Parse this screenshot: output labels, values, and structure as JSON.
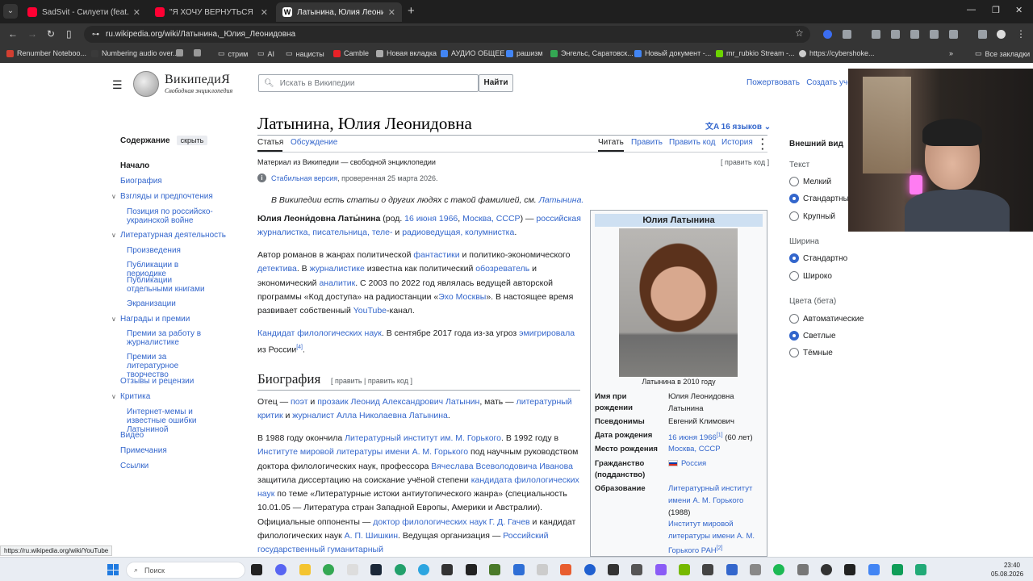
{
  "browser": {
    "tabs": [
      {
        "title": "SadSvit - Силуети (feat. СТРУКТ",
        "color": "#ff0033"
      },
      {
        "title": "\"Я ХОЧУ ВЕРНУТЬСЯ В РОССИЮ",
        "color": "#ff0033"
      },
      {
        "title": "Латынина, Юлия Леонидовна",
        "color": "#ffffff"
      }
    ],
    "url": "ru.wikipedia.org/wiki/Латынина,_Юлия_Леонидовна",
    "bookmarks": [
      "Renumber Noteboo...",
      "Numbering audio over...",
      "стрим",
      "AI",
      "нацисты",
      "Camble",
      "Новая вкладка",
      "АУДИО ОБЩЕЕ",
      "рашизм",
      "Энгельс, Саратовск...",
      "Новый документ -...",
      "mr_rubkio Stream -...",
      "https://cybershoke...",
      "Все закладки"
    ],
    "bookmark_colors": [
      "#d23f31",
      "#3a3a3a",
      "#888",
      "#888",
      "#888",
      "#e82127",
      "#aaa",
      "#4285f4",
      "#4285f4",
      "#34a853",
      "#4285f4",
      "#6cd400",
      "#ccc",
      "#888"
    ]
  },
  "wiki": {
    "wordmark": "ВикипедиЯ",
    "tagline": "Свободная энциклопедия",
    "search_placeholder": "Искать в Википедии",
    "search_button": "Найти",
    "donate": "Пожертвовать",
    "create_account": "Создать учётн",
    "toc_title": "Содержание",
    "toc_hide": "скрыть",
    "toc": [
      "Начало",
      "Биография",
      "Взгляды и предпочтения",
      "Позиция по российско-украинской войне",
      "Литературная деятельность",
      "Произведения",
      "Публикации в периодике",
      "Публикации отдельными книгами",
      "Экранизации",
      "Награды и премии",
      "Премии за работу в журналистике",
      "Премии за литературное творчество",
      "Отзывы и рецензии",
      "Критика",
      "Интернет-мемы и известные ошибки Латыниной",
      "Видео",
      "Примечания",
      "Ссылки"
    ],
    "title": "Латынина, Юлия Леонидовна",
    "languages": "16 языков",
    "tab_article": "Статья",
    "tab_talk": "Обсуждение",
    "tab_read": "Читать",
    "tab_edit": "Править",
    "tab_edit_code": "Править код",
    "tab_history": "История",
    "from": "Материал из Википедии — свободной энциклопедии",
    "edit_code_link": "[ править код ]",
    "stable_link": "Стабильная версия",
    "stable_rest": ", проверенная 25 марта 2026.",
    "hatnote": "В Википедии есть статьи о других людях с такой фамилией, см.",
    "hatnote_link": "Латынина.",
    "p1_name": "Юлия Леони́довна Латы́нина",
    "p1_a": " (род. ",
    "p1_date": "16 июня 1966",
    "p1_place": "Москва, СССР",
    "p1_b": ") — ",
    "p1_jobs": "российская журналистка, писательница, теле-",
    "p1_and": " и ",
    "p1_radio": "радиоведущая, колумнистка",
    "p2_a": "Автор романов в жанрах политической ",
    "p2_l1": "фантастики",
    "p2_b": " и политико-экономического ",
    "p2_l2": "детектива",
    "p2_c": ". В ",
    "p2_l3": "журналистике",
    "p2_d": " известна как политический ",
    "p2_l4": "обозреватель",
    "p2_e": " и экономический ",
    "p2_l5": "аналитик",
    "p2_f": ". С 2003 по 2022 год являлась ведущей авторской программы «Код доступа» на радиостанции «",
    "p2_l6": "Эхо Москвы",
    "p2_g": "». В настоящее время развивает собственный ",
    "p2_l7": "YouTube",
    "p2_h": "-канал.",
    "p3_l1": "Кандидат филологических наук",
    "p3_a": ". В сентябре 2017 года из-за угроз ",
    "p3_l2": "эмигрировала",
    "p3_b": " из России",
    "p3_ref": "[4]",
    "h2_bio": "Биография",
    "h2_edit": "[ править | править код ]",
    "b1_a": "Отец — ",
    "b1_l1": "поэт",
    "b1_b": " и ",
    "b1_l2": "прозаик Леонид Александрович Латынин",
    "b1_c": ", мать — ",
    "b1_l3": "литературный критик",
    "b1_d": " и ",
    "b1_l4": "журналист Алла Николаевна Латынина",
    "b2_a": "В 1988 году окончила ",
    "b2_l1": "Литературный институт им. М. Горького",
    "b2_b": ". В 1992 году в ",
    "b2_l2": "Институте мировой литературы имени А. М. Горького",
    "b2_c": " под научным руководством доктора филологических наук, профессора ",
    "b2_l3": "Вячеслава Всеволодовича Иванова",
    "b2_d": " защитила диссертацию на соискание учёной степени ",
    "b2_l4": "кандидата филологических наук",
    "b2_e": " по теме «Литературные истоки антиутопического жанра» (специальность 10.01.05 — Литература стран Западной Европы, Америки и Австралии). Официальные оппоненты — ",
    "b2_l5": "доктор филологических наук Г. Д. Гачев",
    "b2_f": " и кандидат филологических наук ",
    "b2_l6": "А. П. Шишкин",
    "b2_g": ". Ведущая организация — ",
    "b2_l7": "Российский государственный гуманитарный",
    "infobox": {
      "title": "Юлия Латынина",
      "caption": "Латынина в 2010 году",
      "birth_name_label": "Имя при рождении",
      "birth_name": "Юлия Леонидовна Латынина",
      "pseudonyms_label": "Псевдонимы",
      "pseudonyms": "Евгений Климович",
      "dob_label": "Дата рождения",
      "dob": "16 июня 1966",
      "dob_ref": "[1]",
      "age": " (60 лет)",
      "pob_label": "Место рождения",
      "pob": "Москва, СССР",
      "citizenship_label": "Гражданство (подданство)",
      "citizenship": "Россия",
      "education_label": "Образование",
      "edu1": "Литературный институт имени А. М. Горького",
      "edu1_year": "(1988)",
      "edu2": "Институт мировой литературы имени А. М. Горького РАН",
      "edu2_ref": "[2]"
    },
    "appearance": {
      "title": "Внешний вид",
      "text": "Текст",
      "small": "Мелкий",
      "standard": "Стандартный",
      "large": "Крупный",
      "width": "Ширина",
      "w_standard": "Стандартно",
      "w_wide": "Широко",
      "colors": "Цвета (бета)",
      "auto": "Автоматические",
      "light": "Светлые",
      "dark": "Тёмные"
    }
  },
  "status_url": "https://ru.wikipedia.org/wiki/YouTube",
  "taskbar": {
    "search": "Поиск",
    "time": "23:40",
    "date": "05.08.2026"
  }
}
